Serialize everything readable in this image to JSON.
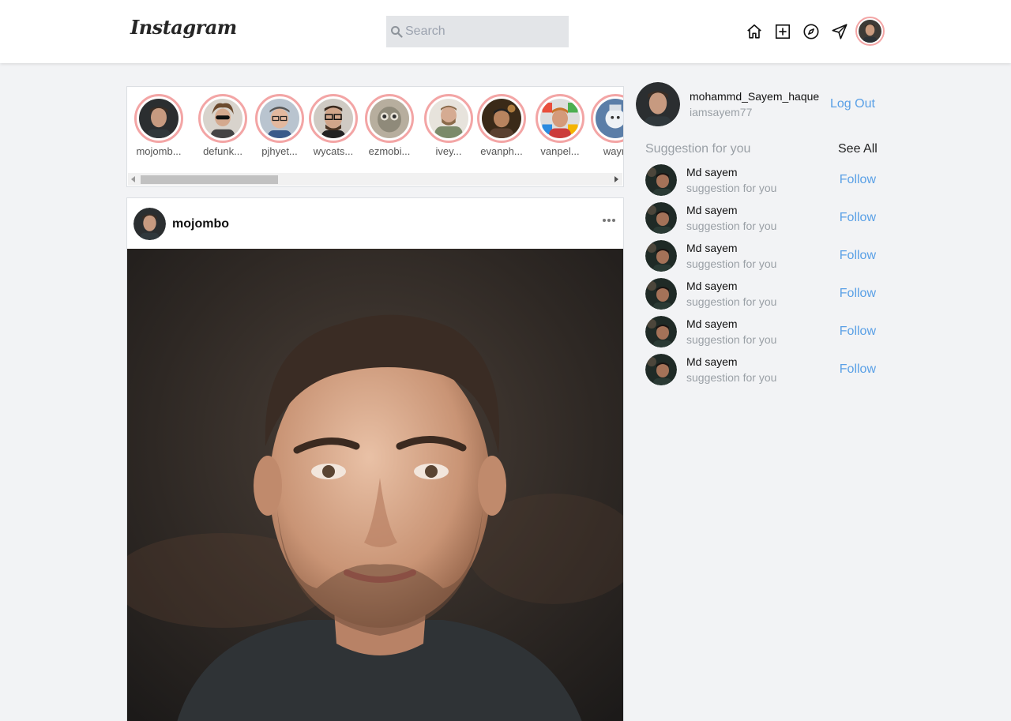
{
  "header": {
    "logo": "Instagram",
    "search_placeholder": "Search",
    "icons": [
      "home-icon",
      "add-post-icon",
      "explore-icon",
      "direct-message-icon"
    ]
  },
  "stories": [
    {
      "username": "mojomb..."
    },
    {
      "username": "defunk..."
    },
    {
      "username": "pjhyet..."
    },
    {
      "username": "wycats..."
    },
    {
      "username": "ezmobi..."
    },
    {
      "username": "ivey..."
    },
    {
      "username": "evanph..."
    },
    {
      "username": "vanpel..."
    },
    {
      "username": "wayn"
    }
  ],
  "post": {
    "username": "mojombo"
  },
  "sidebar": {
    "current_user": {
      "name": "mohammd_Sayem_haque",
      "handle": "iamsayem77",
      "logout_label": "Log Out"
    },
    "suggestions_title": "Suggestion for you",
    "see_all_label": "See All",
    "suggestions": [
      {
        "name": "Md sayem",
        "subtitle": "suggestion for you",
        "action": "Follow"
      },
      {
        "name": "Md sayem",
        "subtitle": "suggestion for you",
        "action": "Follow"
      },
      {
        "name": "Md sayem",
        "subtitle": "suggestion for you",
        "action": "Follow"
      },
      {
        "name": "Md sayem",
        "subtitle": "suggestion for you",
        "action": "Follow"
      },
      {
        "name": "Md sayem",
        "subtitle": "suggestion for you",
        "action": "Follow"
      },
      {
        "name": "Md sayem",
        "subtitle": "suggestion for you",
        "action": "Follow"
      }
    ]
  },
  "colors": {
    "story_ring": "#f3a5a5",
    "link_blue": "#5aa0e6",
    "page_bg": "#f2f3f5"
  }
}
